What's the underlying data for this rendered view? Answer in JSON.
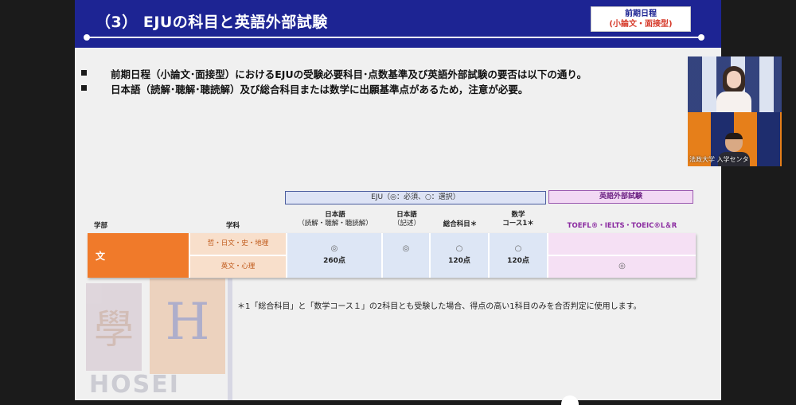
{
  "slide": {
    "title": "（3） EJUの科目と英語外部試験",
    "tag_line1": "前期日程",
    "tag_line2": "(小論文・面接型)",
    "bullets": [
      "前期日程（小論文･面接型）におけるEJUの受験必要科目･点数基準及び英語外部試験の要否は以下の通り。",
      "日本語（読解･聴解･聴読解）及び総合科目または数学に出願基準点があるため，注意が必要。"
    ],
    "watermark_text": "HOSEI",
    "watermark_h": "H",
    "watermark_k": "學",
    "table": {
      "eju_header": "EJU（◎：必須、○：選択）",
      "english_header": "英語外部試験",
      "col_dept": "学部",
      "col_subject": "学科",
      "col_jp_reading": "日本語",
      "col_jp_reading_sub": "（読解・聴解・聴読解）",
      "col_jp_writing": "日本語",
      "col_jp_writing_sub": "（記述）",
      "col_general": "総合科目＊",
      "col_math_line1": "数学",
      "col_math_line2": "コース1＊",
      "col_english": "TOEFL®・IELTS・TOEIC®L＆R",
      "dept_name": "文",
      "subject_1": "哲・日文・史・地理",
      "subject_2": "英文・心理",
      "jp_reading_mark": "◎",
      "jp_reading_value": "260点",
      "jp_writing_mark": "◎",
      "general_mark": "○",
      "general_value": "120点",
      "math_mark": "○",
      "math_value": "120点",
      "english_mark": "◎"
    },
    "footnote": "＊1「総合科目」と「数学コース１」の2科目とも受験した場合、得点の高い1科目のみを合否判定に使用します。"
  },
  "video": {
    "participant_name": "法政大学 入学センタ"
  },
  "colors": {
    "title_bar": "#1d2493",
    "dept_orange": "#f07a2a",
    "eju_blue": "#dde6f5",
    "english_pink": "#f5e0f4"
  }
}
